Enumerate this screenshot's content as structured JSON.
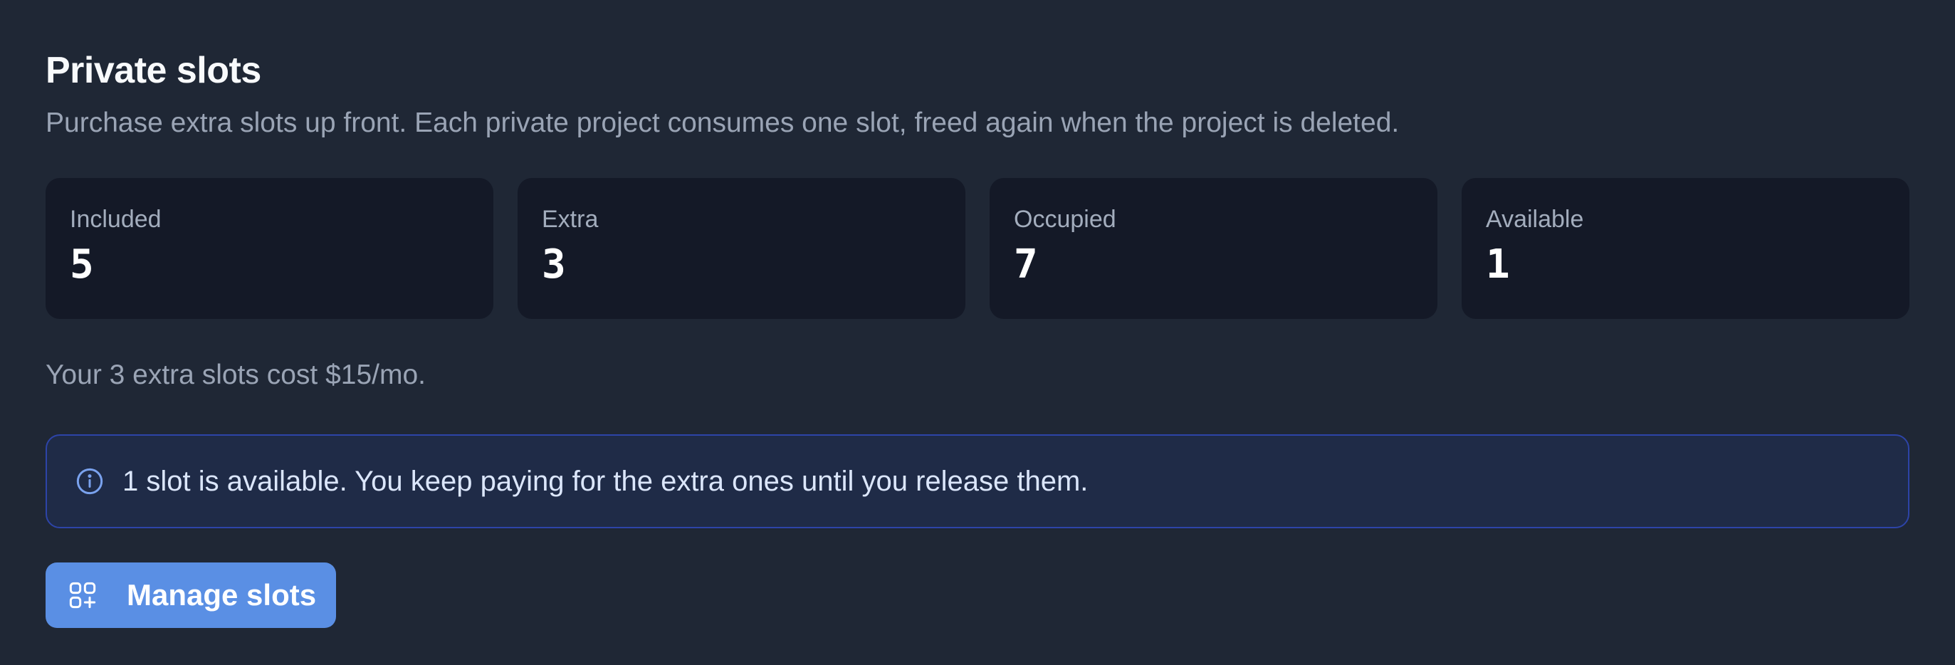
{
  "section": {
    "title": "Private slots",
    "description": "Purchase extra slots up front. Each private project consumes one slot, freed again when the project is deleted."
  },
  "stats": [
    {
      "label": "Included",
      "value": "5"
    },
    {
      "label": "Extra",
      "value": "3"
    },
    {
      "label": "Occupied",
      "value": "7"
    },
    {
      "label": "Available",
      "value": "1"
    }
  ],
  "cost_note": "Your 3 extra slots cost $15/mo.",
  "info_banner": {
    "icon": "info-icon",
    "text": "1 slot is available. You keep paying for the extra ones until you release them."
  },
  "manage_button": {
    "icon": "apps-add-icon",
    "label": "Manage slots"
  },
  "colors": {
    "background": "#1f2735",
    "card": "#141927",
    "accent": "#5a8fe4",
    "banner_border": "#2d44a8",
    "banner_background": "#1f2b47"
  }
}
